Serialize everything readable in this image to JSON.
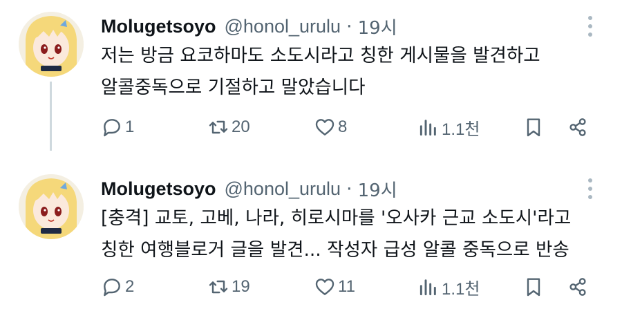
{
  "tweets": [
    {
      "name": "Molugetsoyo",
      "handle": "@honol_urulu",
      "separator": "·",
      "time": "19시",
      "body_lines": [
        "저는 방금 요코하마도 소도시라고 칭한 게시물을 발견하고",
        "알콜중독으로 기절하고 말았습니다"
      ],
      "replies": "1",
      "retweets": "20",
      "likes": "8",
      "views": "1.1천"
    },
    {
      "name": "Molugetsoyo",
      "handle": "@honol_urulu",
      "separator": "·",
      "time": "19시",
      "body_lines": [
        "[충격] 교토, 고베, 나라, 히로시마를 '오사카 근교 소도시'라고",
        "칭한 여행블로거 글을 발견... 작성자 급성 알콜 중독으로 반송"
      ],
      "replies": "2",
      "retweets": "19",
      "likes": "11",
      "views": "1.1천"
    }
  ],
  "icons": {
    "reply": "reply-icon",
    "retweet": "retweet-icon",
    "like": "heart-icon",
    "views": "views-chart-icon",
    "bookmark": "bookmark-icon",
    "share": "share-icon",
    "more": "more-vertical-icon"
  },
  "colors": {
    "text": "#0f1419",
    "muted": "#536471",
    "thread_line": "#cfd9de"
  }
}
